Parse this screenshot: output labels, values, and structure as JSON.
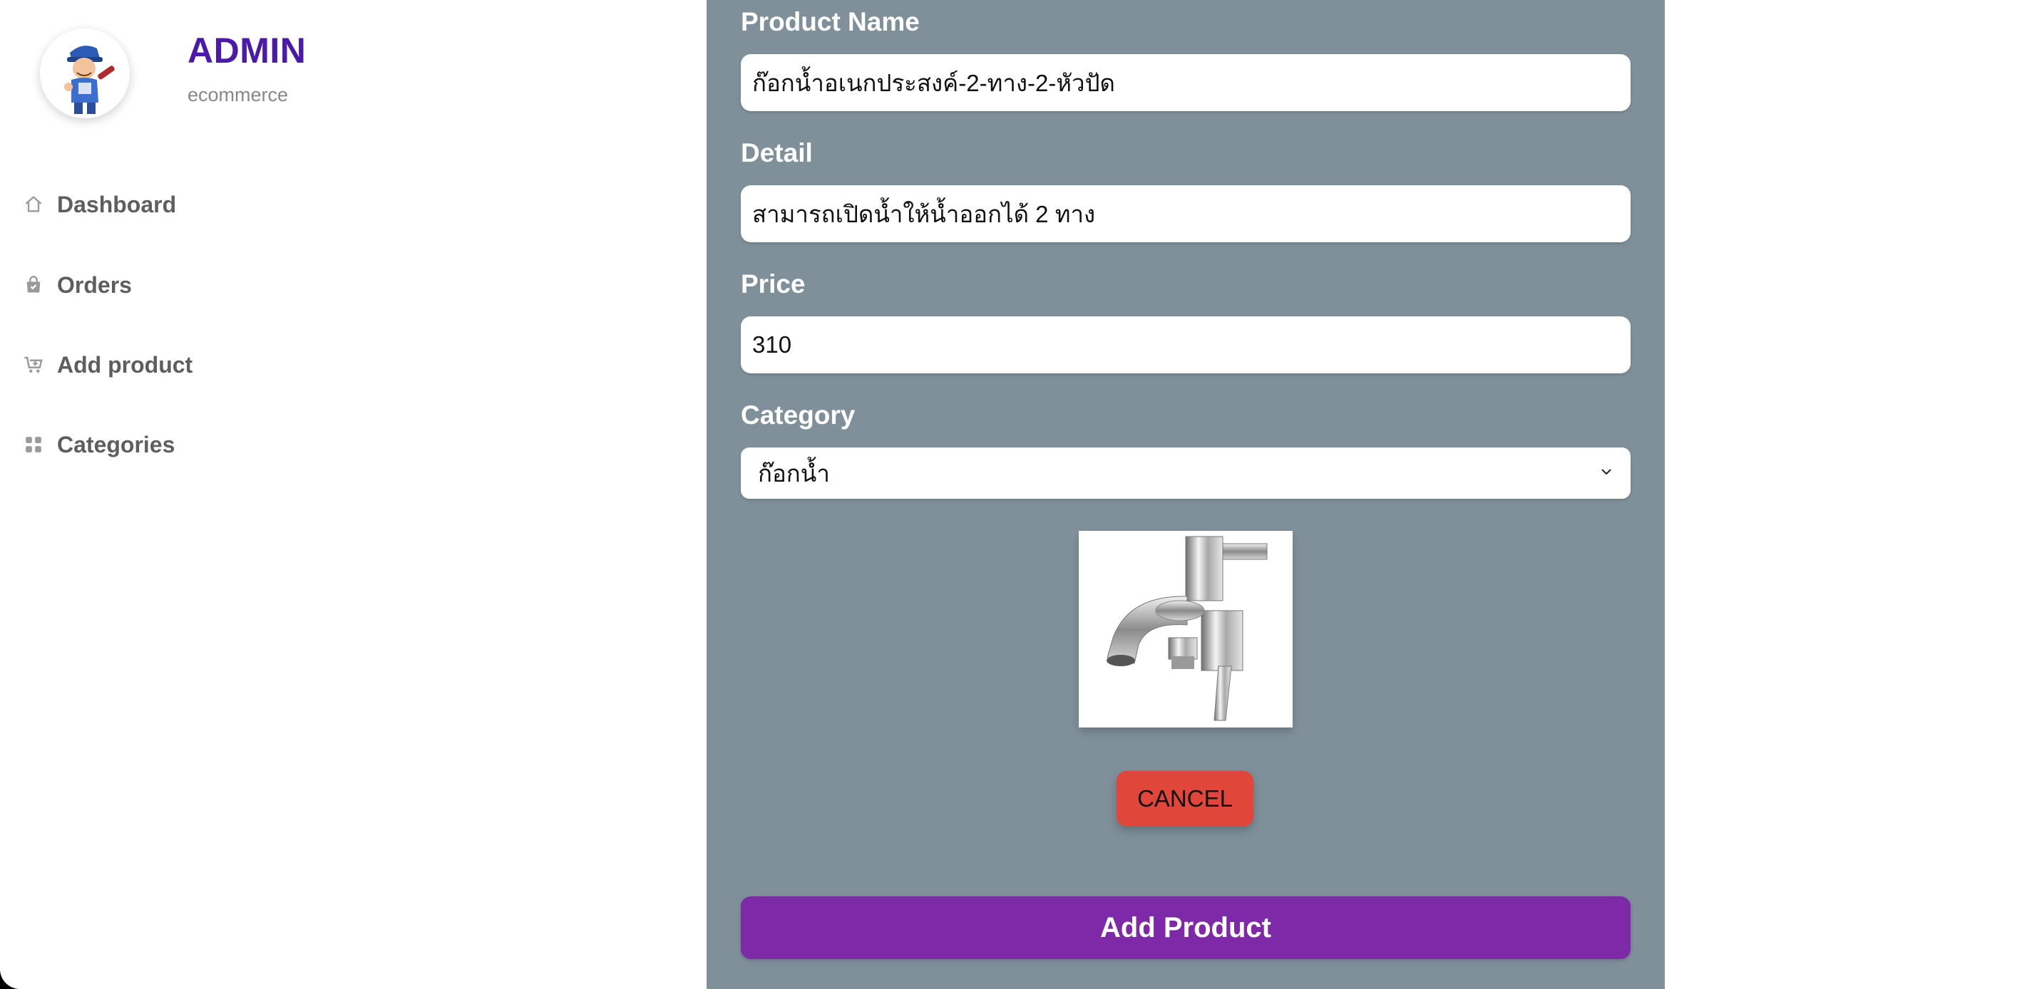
{
  "sidebar": {
    "brand_title": "ADMIN",
    "brand_subtitle": "ecommerce",
    "avatar_icon": "mechanic-mascot",
    "items": [
      {
        "label": "Dashboard",
        "icon": "home-icon"
      },
      {
        "label": "Orders",
        "icon": "shopping-bag-icon"
      },
      {
        "label": "Add product",
        "icon": "cart-plus-icon"
      },
      {
        "label": "Categories",
        "icon": "grid-icon"
      }
    ]
  },
  "form": {
    "product_name_label": "Product Name",
    "product_name_value": "ก๊อกน้ำอเนกประสงค์-2-ทาง-2-หัวปัด",
    "detail_label": "Detail",
    "detail_value": "สามารถเปิดน้ำให้น้ำออกได้ 2 ทาง",
    "price_label": "Price",
    "price_value": "310",
    "category_label": "Category",
    "category_selected": "ก๊อกน้ำ",
    "preview_image": "faucet-image",
    "cancel_label": "CANCEL",
    "submit_label": "Add Product"
  },
  "colors": {
    "brand": "#4b1aa8",
    "panel_bg": "#7f909b",
    "cancel": "#e0473a",
    "submit": "#7e2aa8"
  }
}
